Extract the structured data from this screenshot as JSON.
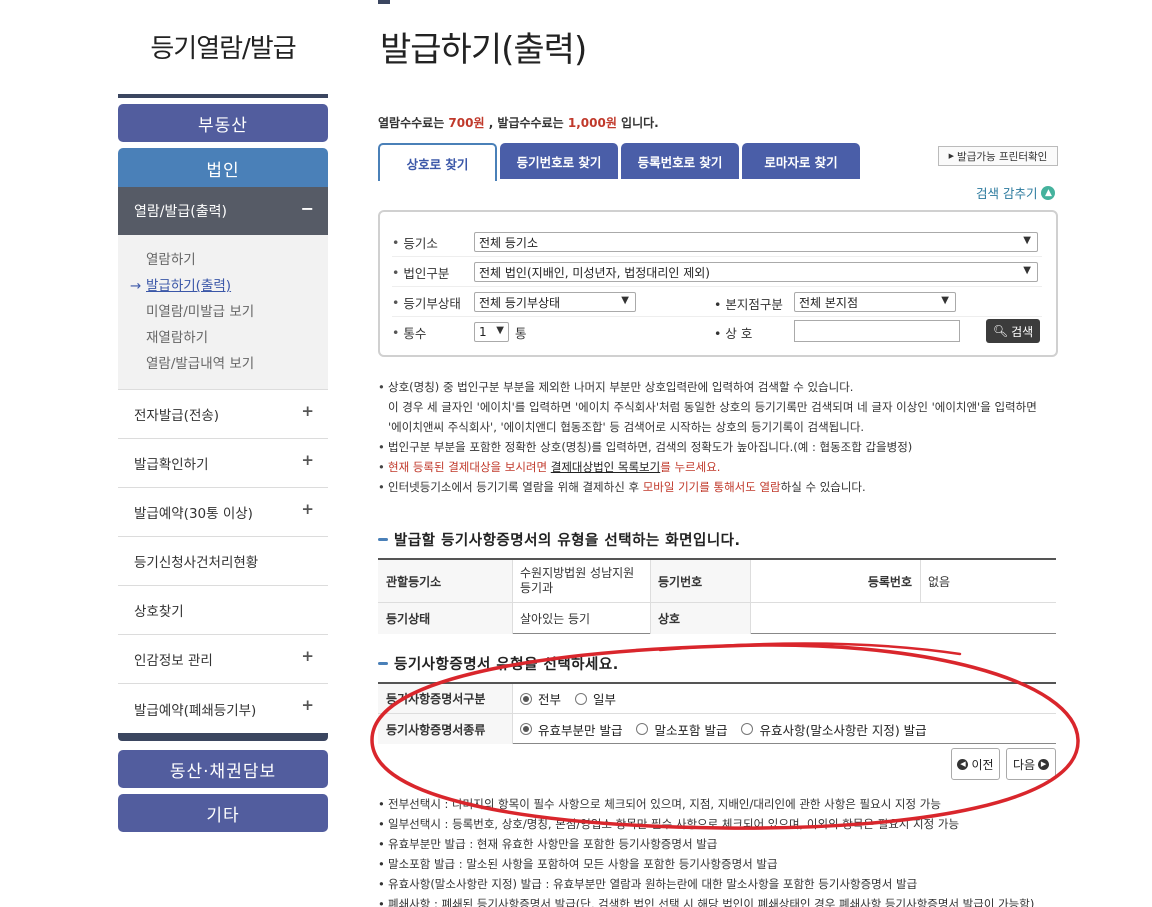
{
  "sidebar": {
    "title": "등기열람/발급",
    "realty_label": "부동산",
    "corp_label": "법인",
    "open_menu_label": "열람/발급(출력)",
    "open_menu_sign": "−",
    "submenu": [
      {
        "label": "열람하기"
      },
      {
        "label": "발급하기(출력)"
      },
      {
        "label": "미열람/미발급 보기"
      },
      {
        "label": "재열람하기"
      },
      {
        "label": "열람/발급내역 보기"
      }
    ],
    "menu": [
      {
        "label": "전자발급(전송)",
        "sign": "+"
      },
      {
        "label": "발급확인하기",
        "sign": "+"
      },
      {
        "label": "발급예약(30통 이상)",
        "sign": "+"
      },
      {
        "label": "등기신청사건처리현황",
        "sign": ""
      },
      {
        "label": "상호찾기",
        "sign": ""
      },
      {
        "label": "인감정보 관리",
        "sign": "+"
      },
      {
        "label": "발급예약(폐쇄등기부)",
        "sign": "+"
      }
    ],
    "movable_label": "동산·채권담보",
    "etc_label": "기타"
  },
  "main": {
    "page_title": "발급하기(출력)",
    "fee": {
      "prefix": "열람수수료는 ",
      "view_fee": "700원",
      "middle": " , 발급수수료는 ",
      "issue_fee": "1,000원",
      "suffix": " 입니다."
    },
    "tabs": [
      {
        "label": "상호로 찾기"
      },
      {
        "label": "등기번호로 찾기"
      },
      {
        "label": "등록번호로 찾기"
      },
      {
        "label": "로마자로 찾기"
      }
    ],
    "printer_check_label": "발급가능 프린터확인",
    "collapse_label": "검색 감추기",
    "search": {
      "registry_label": "등기소",
      "registry_value": "전체 등기소",
      "corp_type_label": "법인구분",
      "corp_type_value": "전체 법인(지배인, 미성년자, 법정대리인 제외)",
      "status_label": "등기부상태",
      "status_value": "전체 등기부상태",
      "branch_label": "본지점구분",
      "branch_value": "전체 본지점",
      "copies_label": "통수",
      "copies_value": "1",
      "copies_unit": "통",
      "name_label": "상 호",
      "search_button": "검색"
    },
    "notes": {
      "n1": "상호(명칭) 중 법인구분 부분을 제외한 나머지 부분만 상호입력란에 입력하여 검색할 수 있습니다.",
      "n1a": "이 경우 세 글자인 '에이치'를 입력하면 '에이치 주식회사'처럼 동일한 상호의 등기기록만 검색되며 네 글자 이상인 '에이치앤'을 입력하면",
      "n1b": "'에이치앤씨 주식회사', '에이치앤디 협동조합' 등 검색어로 시작하는 상호의 등기기록이 검색됩니다.",
      "n2": "법인구분 부분을 포함한 정확한 상호(명칭)를 입력하면, 검색의 정확도가 높아집니다.(예 : 협동조합 갑을병정)",
      "n3_red1": "현재 등록된 결제대상을 보시려면 ",
      "n3_link": "결제대상법인 목록보기",
      "n3_red2": "를 누르세요.",
      "n4a": "인터넷등기소에서 등기기록 열람을 위해 결제하신 후 ",
      "n4_red": "모바일 기기를 통해서도 열람",
      "n4b": "하실 수 있습니다."
    },
    "section1_title": "발급할 등기사항증명서의 유형을 선택하는 화면입니다.",
    "info": {
      "jurisdiction_label": "관할등기소",
      "jurisdiction_value_1": "수원지방법원 성남지원",
      "jurisdiction_value_2": "등기과",
      "reg_no_label": "등기번호",
      "reg_no_value": "",
      "registration_label": "등록번호",
      "registration_value": "없음",
      "status_label": "등기상태",
      "status_value": "살아있는 등기",
      "name_label": "상호",
      "name_value": ""
    },
    "section2_title": "등기사항증명서 유형을 선택하세요.",
    "type": {
      "scope_label": "등기사항증명서구분",
      "scope_options": [
        "전부",
        "일부"
      ],
      "kind_label": "등기사항증명서종류",
      "kind_options": [
        "유효부분만 발급",
        "말소포함 발급",
        "유효사항(말소사항란 지정) 발급"
      ]
    },
    "prev_button": "이전",
    "next_button": "다음",
    "bottom_notes": [
      "전부선택시 : 나머지의 항목이 필수 사항으로 체크되어 있으며, 지점, 지배인/대리인에 관한 사항은 필요시 지정 가능",
      "일부선택시 : 등록번호, 상호/명칭, 본점/영업소 항목만 필수 사항으로 체크되어 있으며, 이외의 항목은 필요시 지정 가능",
      "유효부분만 발급 : 현재 유효한 사항만을 포함한 등기사항증명서 발급",
      "말소포함 발급 : 말소된 사항을 포함하여 모든 사항을 포함한 등기사항증명서 발급",
      "유효사항(말소사항란 지정) 발급 : 유효부분만 열람과 원하는란에 대한 말소사항을 포함한 등기사항증명서 발급",
      "폐쇄사항 : 폐쇄된 등기사항증명서 발급(단, 검색한 법인 선택 시 해당 법인이 폐쇄상태인 경우 폐쇄사항 등기사항증명서 발급이 가능함)"
    ]
  },
  "colors": {
    "sidebar_button": "#525d9e",
    "corp_button": "#4a80b8",
    "annotation": "#d9262c",
    "fee_red": "#c0392b"
  }
}
